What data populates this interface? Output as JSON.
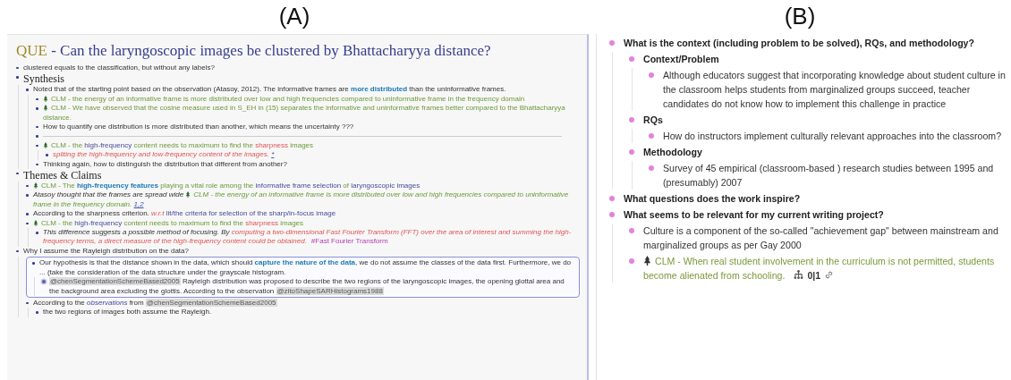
{
  "panels": [
    {
      "label": "(A)"
    },
    {
      "label": "(B)"
    }
  ],
  "panel_a": {
    "title": {
      "tag": "QUE",
      "text": "- Can the laryngoscopic images be clustered by Bhattacharyya distance?"
    },
    "blocks": [
      {
        "segs": [
          {
            "kind": "text",
            "text": "clustered  equals to the classification, but without any labels?"
          }
        ]
      },
      {
        "kind": "heading",
        "text": "Synthesis",
        "children": [
          {
            "segs": [
              {
                "kind": "text",
                "text": "Noted that of the starting point based on the observation (Atasoy, 2012). The informative frames are "
              },
              {
                "kind": "strong",
                "text": "more distributed"
              },
              {
                "kind": "text",
                "text": " than the uninformative frames."
              }
            ],
            "children": [
              {
                "segs": [
                  {
                    "kind": "tree"
                  },
                  {
                    "kind": "clm",
                    "text": "CLM - the energy of an informative frame is more distributed over low and high frequencies compared to uninformative frame in the frequency domain"
                  }
                ]
              },
              {
                "segs": [
                  {
                    "kind": "tree"
                  },
                  {
                    "kind": "clm",
                    "text": "CLM - We have observed that the cosine measure used in S_EH in (15) separates the informative and uninformative frames better compared to the Bhattacharyya distance."
                  }
                ]
              },
              {
                "segs": [
                  {
                    "kind": "text",
                    "text": "How to quantify one distribution is more distributed than another, which means the uncertainty ???"
                  }
                ]
              },
              {
                "kind": "divider"
              },
              {
                "segs": [
                  {
                    "kind": "tree"
                  },
                  {
                    "kind": "clm",
                    "text": "CLM - the "
                  },
                  {
                    "kind": "blue",
                    "text": "high-frequency"
                  },
                  {
                    "kind": "clm",
                    "text": " content needs to maximum to find the "
                  },
                  {
                    "kind": "red",
                    "text": "sharpness"
                  },
                  {
                    "kind": "clm",
                    "text": " images"
                  }
                ],
                "children": [
                  {
                    "segs": [
                      {
                        "kind": "redem",
                        "text": "spliting the high-frequency and low-frequency content of the images. "
                      },
                      {
                        "kind": "ref",
                        "text": "*"
                      }
                    ]
                  }
                ]
              },
              {
                "segs": [
                  {
                    "kind": "text",
                    "text": "Thinking again, how to distinguish the distribution that different from another?"
                  }
                ]
              }
            ]
          }
        ]
      },
      {
        "kind": "heading",
        "text": "Themes & Claims",
        "children": [
          {
            "segs": [
              {
                "kind": "tree"
              },
              {
                "kind": "clm",
                "text": "CLM - The "
              },
              {
                "kind": "strong",
                "text": "high-frequency features"
              },
              {
                "kind": "clm",
                "text": " playing a vital role among the "
              },
              {
                "kind": "blue",
                "text": "informative frame selection"
              },
              {
                "kind": "clm",
                "text": " of "
              },
              {
                "kind": "blue",
                "text": "laryngoscopic images"
              }
            ]
          },
          {
            "segs": [
              {
                "kind": "em",
                "text": "Atasoy thought that the frames are spread wide "
              },
              {
                "kind": "tree"
              },
              {
                "kind": "clmem",
                "text": "CLM - the energy of an informative frame is more distributed over low and high frequencies compared to uninformative frame in the frequency domain. "
              },
              {
                "kind": "ref",
                "text": "1,2"
              }
            ]
          },
          {
            "segs": [
              {
                "kind": "text",
                "text": "According to the sharpness criterion. "
              },
              {
                "kind": "redem",
                "text": "w.r.t"
              },
              {
                "kind": "blue",
                "text": " lit/the criteria for selection of the sharp/in-focus image"
              }
            ]
          },
          {
            "segs": [
              {
                "kind": "tree"
              },
              {
                "kind": "clm",
                "text": "CLM - the "
              },
              {
                "kind": "blue",
                "text": "high-frequency"
              },
              {
                "kind": "clm",
                "text": " content needs to maximum to find the "
              },
              {
                "kind": "red",
                "text": "sharpness"
              },
              {
                "kind": "clm",
                "text": " images"
              }
            ],
            "children": [
              {
                "segs": [
                  {
                    "kind": "em",
                    "text": "This difference suggests a possible method of focusing. By "
                  },
                  {
                    "kind": "redem",
                    "text": "computing a two-dimensional Fast Fourier Transform (FFT) over the area of interest and summing the high-frequency terms, a direct measure of the high-frequency content could be obtained."
                  },
                  {
                    "kind": "tag",
                    "text": "#Fast Fourier Transform"
                  }
                ]
              }
            ]
          }
        ]
      },
      {
        "segs": [
          {
            "kind": "text",
            "text": "Why I assume the Rayleigh distribution on the data?"
          }
        ],
        "children": [
          {
            "kind": "embed",
            "children": [
              {
                "segs": [
                  {
                    "kind": "text",
                    "text": "Our hypothesis is that the distance shown in the data, which should "
                  },
                  {
                    "kind": "strong",
                    "text": "capture the nature of the data"
                  },
                  {
                    "kind": "text",
                    "text": ", we do not assume the classes of the data first. Furthermore, we do ... (take the consideration of the data structure under the grayscale histogram."
                  }
                ],
                "children": [
                  {
                    "collapsed": true,
                    "segs": [
                      {
                        "kind": "cite",
                        "text": "@chenSegmentationSchemeBased2005"
                      },
                      {
                        "kind": "text",
                        "text": " Rayleigh distribution was proposed to describe the two regions of the laryngoscopic images, the opening glottal area and the background area excluding the glottis. According to the observation "
                      },
                      {
                        "kind": "cite",
                        "text": "@zitoShapeSARHistograms1988"
                      }
                    ]
                  }
                ]
              }
            ]
          },
          {
            "segs": [
              {
                "kind": "text",
                "text": "According to the "
              },
              {
                "kind": "blueem",
                "text": "observations"
              },
              {
                "kind": "text",
                "text": " from  "
              },
              {
                "kind": "cite",
                "text": "@chenSegmentationSchemeBased2005"
              }
            ],
            "children": [
              {
                "segs": [
                  {
                    "kind": "text",
                    "text": "the two regions of images both assume the Rayleigh."
                  }
                ]
              }
            ]
          }
        ]
      }
    ]
  },
  "panel_b": {
    "blocks": [
      {
        "segs": [
          {
            "kind": "bold",
            "text": "What is the context (including problem to be solved), RQs, and methodology?"
          }
        ],
        "children": [
          {
            "segs": [
              {
                "kind": "bold",
                "text": "Context/Problem"
              }
            ],
            "children": [
              {
                "segs": [
                  {
                    "kind": "text",
                    "text": "Although educators suggest that incorporating knowledge about student culture in the classroom helps students from marginalized groups succeed, teacher candidates do not know how to implement this challenge in practice"
                  }
                ]
              }
            ]
          },
          {
            "segs": [
              {
                "kind": "bold",
                "text": "RQs"
              }
            ],
            "children": [
              {
                "segs": [
                  {
                    "kind": "text",
                    "text": "How do instructors implement culturally relevant approaches into the classroom?"
                  }
                ]
              }
            ]
          },
          {
            "segs": [
              {
                "kind": "bold",
                "text": "Methodology"
              }
            ],
            "children": [
              {
                "segs": [
                  {
                    "kind": "text",
                    "text": "Survey of 45 empirical (classroom-based ) research studies between 1995 and (presumably) 2007"
                  }
                ]
              }
            ]
          }
        ]
      },
      {
        "segs": [
          {
            "kind": "bold",
            "text": "What questions does the work inspire?"
          }
        ]
      },
      {
        "segs": [
          {
            "kind": "bold",
            "text": "What seems to be relevant for my current writing project?"
          }
        ],
        "children": [
          {
            "segs": [
              {
                "kind": "text",
                "text": "Culture is a component of the so-called \"achievement gap\" between mainstream and marginalized groups as per Gay 2000"
              }
            ]
          },
          {
            "segs": [
              {
                "kind": "tree"
              },
              {
                "kind": "clm",
                "text": "CLM - When real student involvement in the curriculum is not permitted, students become alienated from schooling."
              }
            ],
            "refs_count": "0|1"
          }
        ]
      }
    ]
  }
}
